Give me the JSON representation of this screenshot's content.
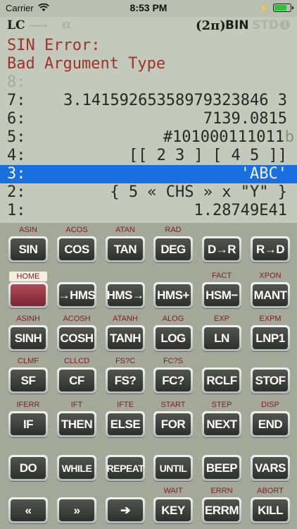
{
  "statusbar": {
    "carrier": "Carrier",
    "time": "8:53 PM",
    "battery_level": 0.75
  },
  "annunciators": {
    "lc": "LC",
    "alpha": "α",
    "angle": "(2π)",
    "base": "BIN",
    "mode": "STD"
  },
  "stack": {
    "error_title": "SIN Error:",
    "error_msg": "Bad Argument Type",
    "levels": [
      {
        "n": "8:",
        "v": ""
      },
      {
        "n": "7:",
        "v": "3.14159265358979323846 3"
      },
      {
        "n": "6:",
        "v": "7139.0815"
      },
      {
        "n": "5:",
        "v": "#101000111011",
        "suffix": "b"
      },
      {
        "n": "4:",
        "v": "[[ 2 3 ] [ 4 5 ]]"
      },
      {
        "n": "3:",
        "v": "'ABC'"
      },
      {
        "n": "2:",
        "v": "{ 5 « CHS » x \"Y\" }"
      },
      {
        "n": "1:",
        "v": "1.28749E41"
      }
    ]
  },
  "keys": [
    {
      "label": "SIN",
      "shift": "ASIN"
    },
    {
      "label": "COS",
      "shift": "ACOS"
    },
    {
      "label": "TAN",
      "shift": "ATAN"
    },
    {
      "label": "DEG",
      "shift": "RAD"
    },
    {
      "label": "D→R",
      "shift": ""
    },
    {
      "label": "R→D",
      "shift": ""
    },
    {
      "label": "",
      "shift": "HOME"
    },
    {
      "label": "→HMS",
      "shift": ""
    },
    {
      "label": "HMS→",
      "shift": ""
    },
    {
      "label": "HMS+",
      "shift": ""
    },
    {
      "label": "HSM−",
      "shift": "FACT"
    },
    {
      "label": "MANT",
      "shift": "XPON"
    },
    {
      "label": "SINH",
      "shift": "ASINH"
    },
    {
      "label": "COSH",
      "shift": "ACOSH"
    },
    {
      "label": "TANH",
      "shift": "ATANH"
    },
    {
      "label": "LOG",
      "shift": "ALOG"
    },
    {
      "label": "LN",
      "shift": "EXP"
    },
    {
      "label": "LNP1",
      "shift": "EXPM"
    },
    {
      "label": "SF",
      "shift": "CLMF"
    },
    {
      "label": "CF",
      "shift": "CLLCD"
    },
    {
      "label": "FS?",
      "shift": "FS?C"
    },
    {
      "label": "FC?",
      "shift": "FC?S"
    },
    {
      "label": "RCLF",
      "shift": ""
    },
    {
      "label": "STOF",
      "shift": ""
    },
    {
      "label": "IF",
      "shift": "IFERR"
    },
    {
      "label": "THEN",
      "shift": "IFT"
    },
    {
      "label": "ELSE",
      "shift": "IFTE"
    },
    {
      "label": "FOR",
      "shift": "START"
    },
    {
      "label": "NEXT",
      "shift": "STEP"
    },
    {
      "label": "END",
      "shift": "DISP"
    },
    {
      "label": "DO",
      "shift": ""
    },
    {
      "label": "WHILE",
      "shift": ""
    },
    {
      "label": "REPEAT",
      "shift": ""
    },
    {
      "label": "UNTIL",
      "shift": ""
    },
    {
      "label": "BEEP",
      "shift": ""
    },
    {
      "label": "VARS",
      "shift": ""
    },
    {
      "label": "«",
      "shift": ""
    },
    {
      "label": "»",
      "shift": ""
    },
    {
      "label": "➔",
      "shift": ""
    },
    {
      "label": "KEY",
      "shift": "WAIT"
    },
    {
      "label": "ERRM",
      "shift": "ERRN"
    },
    {
      "label": "KILL",
      "shift": "ABORT"
    }
  ]
}
